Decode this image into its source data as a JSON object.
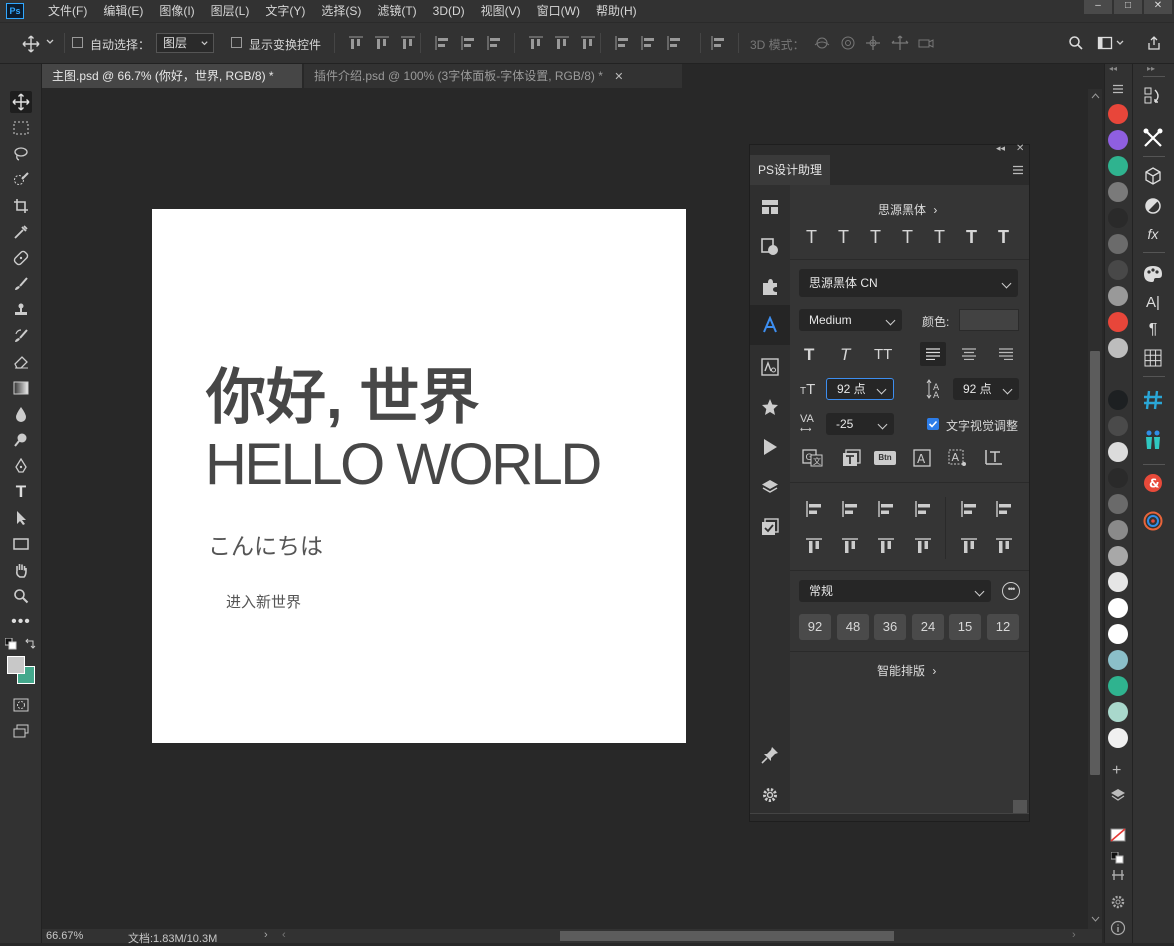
{
  "app": {
    "logo": "Ps"
  },
  "menu": [
    "文件(F)",
    "编辑(E)",
    "图像(I)",
    "图层(L)",
    "文字(Y)",
    "选择(S)",
    "滤镜(T)",
    "3D(D)",
    "视图(V)",
    "窗口(W)",
    "帮助(H)"
  ],
  "options_bar": {
    "auto_select_label": "自动选择：",
    "auto_select_value": "图层",
    "show_transform_label": "显示变换控件",
    "mode_3d_label": "3D 模式："
  },
  "tabs": [
    {
      "label": "主图.psd @ 66.7% (你好，世界, RGB/8) *",
      "active": true
    },
    {
      "label": "插件介绍.psd @ 100% (3字体面板-字体设置, RGB/8) *",
      "active": false
    }
  ],
  "artboard": {
    "line1": "你好, 世界",
    "line2": "HELLO WORLD",
    "line3": "こんにちは",
    "line4": "进入新世界"
  },
  "status": {
    "zoom": "66.67%",
    "doc": "文档:1.83M/10.3M"
  },
  "panel": {
    "title": "PS设计助理",
    "font_family_link": "思源黑体",
    "font_select": "思源黑体 CN",
    "weight_select": "Medium",
    "color_label": "颜色:",
    "font_size": "92 点",
    "leading": "92 点",
    "tracking": "-25",
    "optical_label": "文字视觉调整",
    "style_select": "常规",
    "sizes": [
      "92",
      "48",
      "36",
      "24",
      "15",
      "12"
    ],
    "smart_layout": "智能排版"
  },
  "swatch_colors": [
    "#e8463a",
    "#8f5fe0",
    "#2fb38f",
    "#7a7a7a",
    "#2a2a2a",
    "#6b6b6b",
    "#484848",
    "#999999",
    "#e8463a",
    "#bdbdbd",
    "#1d2022",
    "#4a4a4a",
    "#dcdcdc",
    "#2a2a2a",
    "#6a6a6a",
    "#8a8a8a",
    "#a8a8a8",
    "#e6e6e6",
    "#ffffff",
    "#ffffff",
    "#8bbfc9",
    "#2fb38f",
    "#a9d8cc",
    "#f0f0f0"
  ]
}
